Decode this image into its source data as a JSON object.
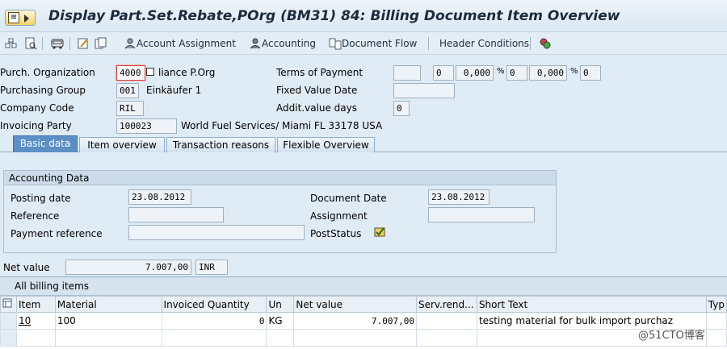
{
  "header": {
    "title": "Display Part.Set.Rebate,POrg (BM31) 84: Billing Document Item Overview"
  },
  "toolbar": {
    "account_assignment": "Account Assignment",
    "accounting": "Accounting",
    "document_flow": "Document Flow",
    "header_conditions": "Header Conditions"
  },
  "form": {
    "purch_org_label": "Purch. Organization",
    "purch_org_value": "4000",
    "purch_org_text": "liance  P.Org",
    "purch_group_label": "Purchasing Group",
    "purch_group_value": "001",
    "purch_group_text": "Einkäufer 1",
    "company_code_label": "Company Code",
    "company_code_value": "RIL",
    "invoicing_party_label": "Invoicing Party",
    "invoicing_party_value": "100023",
    "invoicing_party_text": "World Fuel Services/ Miami FL  33178 USA",
    "terms_label": "Terms of Payment",
    "terms_value": "",
    "terms_days1": "0",
    "terms_pct1": "0,000",
    "terms_pct_sign1": "%",
    "terms_days2": "0",
    "terms_pct2": "0,000",
    "terms_pct_sign2": "%",
    "terms_days3": "0",
    "fixed_value_date_label": "Fixed Value Date",
    "fixed_value_date_value": "",
    "addit_value_days_label": "Addit.value days",
    "addit_value_days_value": "0"
  },
  "tabs": [
    {
      "label": "Basic data"
    },
    {
      "label": "Item overview"
    },
    {
      "label": "Transaction reasons"
    },
    {
      "label": "Flexible Overview"
    }
  ],
  "accounting_data": {
    "title": "Accounting Data",
    "posting_date_label": "Posting date",
    "posting_date_value": "23.08.2012",
    "reference_label": "Reference",
    "reference_value": "",
    "payment_reference_label": "Payment reference",
    "payment_reference_value": "",
    "document_date_label": "Document Date",
    "document_date_value": "23.08.2012",
    "assignment_label": "Assignment",
    "assignment_value": "",
    "post_status_label": "PostStatus"
  },
  "net_value": {
    "label": "Net value",
    "value": "7.007,00",
    "currency": "INR"
  },
  "billing_items": {
    "caption": "All billing items",
    "columns": [
      "Item",
      "Material",
      "Invoiced Quantity",
      "Un",
      "Net value",
      "Serv.rend...",
      "Short Text",
      "Typ"
    ],
    "rows": [
      {
        "item": "10",
        "material": "100",
        "qty": "0",
        "unit": "KG",
        "net_value": "7.007,00",
        "serv_rendered": "",
        "short_text": "testing material for bulk import purchaz",
        "type": ""
      }
    ]
  },
  "watermark": "@51CTO博客",
  "colors": {
    "background": "#dfebf5",
    "active_tab": "#5b8fc5",
    "focus_border": "#d64545"
  }
}
